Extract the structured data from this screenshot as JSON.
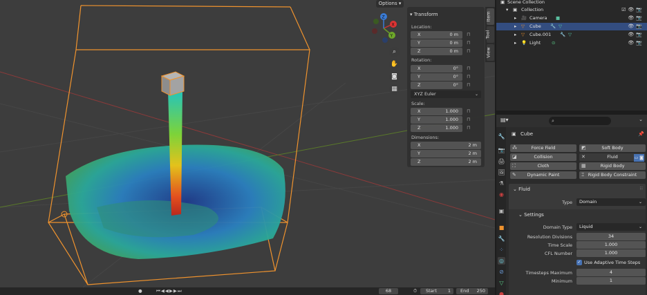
{
  "viewport": {
    "options_label": "Options",
    "gizmo": {
      "x": "X",
      "y": "Y",
      "z": "Z"
    }
  },
  "npanel": {
    "header": "Transform",
    "location": {
      "label": "Location:",
      "x": "0 m",
      "y": "0 m",
      "z": "0 m"
    },
    "rotation": {
      "label": "Rotation:",
      "x": "0°",
      "y": "0°",
      "z": "0°",
      "mode": "XYZ Euler"
    },
    "scale": {
      "label": "Scale:",
      "x": "1.000",
      "y": "1.000",
      "z": "1.000"
    },
    "dimensions": {
      "label": "Dimensions:",
      "x": "2 m",
      "y": "2 m",
      "z": "2 m"
    },
    "axis": {
      "x": "X",
      "y": "Y",
      "z": "Z"
    },
    "tabs": [
      "Item",
      "Tool",
      "View"
    ]
  },
  "outliner": {
    "root": "Scene Collection",
    "collection": "Collection",
    "items": [
      {
        "name": "Camera"
      },
      {
        "name": "Cube"
      },
      {
        "name": "Cube.001"
      },
      {
        "name": "Light"
      }
    ]
  },
  "properties": {
    "search_placeholder": "",
    "object_name": "Cube",
    "physics_buttons": {
      "force_field": "Force Field",
      "soft_body": "Soft Body",
      "collision": "Collision",
      "fluid": "Fluid",
      "cloth": "Cloth",
      "rigid_body": "Rigid Body",
      "dynamic_paint": "Dynamic Paint",
      "rigid_body_constraint": "Rigid Body Constraint"
    },
    "fluid_panel": {
      "title": "Fluid",
      "type_label": "Type",
      "type_value": "Domain",
      "settings_title": "Settings",
      "domain_type_label": "Domain Type",
      "domain_type_value": "Liquid",
      "resolution_label": "Resolution Divisions",
      "resolution_value": "34",
      "time_scale_label": "Time Scale",
      "time_scale_value": "1.000",
      "cfl_label": "CFL Number",
      "cfl_value": "1.000",
      "adaptive_label": "Use Adaptive Time Steps",
      "timesteps_max_label": "Timesteps Maximum",
      "timesteps_max_value": "4",
      "minimum_label": "Minimum",
      "minimum_value": "1"
    }
  },
  "timeline": {
    "current_frame": "68",
    "start_label": "Start",
    "start_value": "1",
    "end_label": "End",
    "end_value": "250"
  }
}
